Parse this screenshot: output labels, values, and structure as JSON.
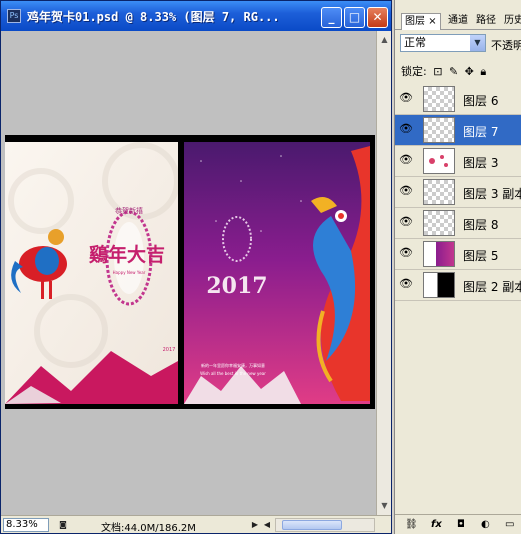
{
  "document": {
    "title": "鸡年贺卡01.psd @ 8.33% (图层 7, RG...",
    "app_icon_label": "Ps",
    "window_buttons": {
      "minimize": "_",
      "maximize": "□",
      "close": "✕"
    },
    "zoom": "8.33%",
    "doc_info": "文档:44.0M/186.2M",
    "artwork": {
      "left_card": {
        "badge_text": "恭贺新禧",
        "headline": "鷄年大吉",
        "subtitle": "Happy New Year",
        "year_mark": "2017"
      },
      "right_card": {
        "year_text": "2017",
        "blurb_line1": "新的一年里愿你幸福安康，万事如意",
        "blurb_line2": "Wish all the best in the new year"
      }
    }
  },
  "panel": {
    "tabs": [
      "图层",
      "通道",
      "路径",
      "历史"
    ],
    "tab_close": "×",
    "blend_mode": "正常",
    "opacity_label": "不透明",
    "lock_label": "锁定:",
    "layers": [
      {
        "name": "图层 6",
        "selected": false,
        "thumb": "transparent"
      },
      {
        "name": "图层 7",
        "selected": true,
        "thumb": "transparent"
      },
      {
        "name": "图层 3",
        "selected": false,
        "thumb": "flowers"
      },
      {
        "name": "图层 3 副本",
        "selected": false,
        "thumb": "transparent"
      },
      {
        "name": "图层 8",
        "selected": false,
        "thumb": "transparent"
      },
      {
        "name": "图层 5",
        "selected": false,
        "thumb": "purple"
      },
      {
        "name": "图层 2 副本",
        "selected": false,
        "thumb": "black-white"
      }
    ],
    "footer_icons": [
      "link-icon",
      "fx-icon",
      "mask-icon",
      "adjustment-icon",
      "folder-icon"
    ]
  },
  "colors": {
    "selection": "#316ac5",
    "title_bar": "#0a4ac7",
    "card_purple": "#8a1d8e",
    "card_pink": "#d6237a"
  }
}
